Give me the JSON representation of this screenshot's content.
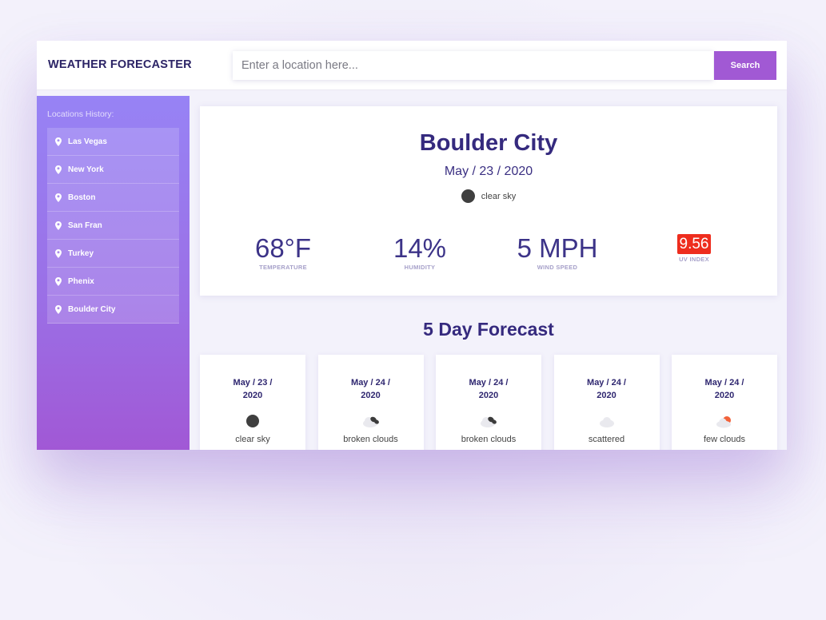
{
  "header": {
    "brand": "WEATHER FORECASTER",
    "search_placeholder": "Enter a location here...",
    "search_label": "Search"
  },
  "sidebar": {
    "title": "Locations History:",
    "items": [
      {
        "label": "Las Vegas",
        "icon": "map-pin-icon"
      },
      {
        "label": "New York",
        "icon": "map-pin-icon"
      },
      {
        "label": "Boston",
        "icon": "map-pin-icon"
      },
      {
        "label": "San Fran",
        "icon": "map-pin-icon"
      },
      {
        "label": "Turkey",
        "icon": "map-pin-icon"
      },
      {
        "label": "Phenix",
        "icon": "map-pin-icon"
      },
      {
        "label": "Boulder City",
        "icon": "map-pin-icon"
      }
    ]
  },
  "current": {
    "city": "Boulder City",
    "date": "May / 23 / 2020",
    "condition": "clear sky",
    "condition_icon": "clear-sky-icon",
    "temperature": "68°F",
    "temperature_label": "TEMPERATURE",
    "humidity": "14%",
    "humidity_label": "HUMIDITY",
    "wind": "5 MPH",
    "wind_label": "WIND SPEED",
    "uv": "9.56",
    "uv_label": "UV INDEX"
  },
  "forecast": {
    "title": "5 Day Forecast",
    "days": [
      {
        "date_line1": "May / 23 /",
        "date_line2": "2020",
        "desc": "clear sky",
        "icon": "clear-sky-icon"
      },
      {
        "date_line1": "May / 24 /",
        "date_line2": "2020",
        "desc": "broken clouds",
        "icon": "broken-clouds-icon"
      },
      {
        "date_line1": "May / 24 /",
        "date_line2": "2020",
        "desc": "broken clouds",
        "icon": "broken-clouds-icon"
      },
      {
        "date_line1": "May / 24 /",
        "date_line2": "2020",
        "desc": "scattered",
        "icon": "scattered-clouds-icon"
      },
      {
        "date_line1": "May / 24 /",
        "date_line2": "2020",
        "desc": "few clouds",
        "icon": "few-clouds-icon"
      }
    ]
  },
  "colors": {
    "brand_text": "#2c2466",
    "accent_button": "#a159d4",
    "sidebar_top": "#9783f5",
    "sidebar_bottom": "#a158d5",
    "heading": "#352a7e",
    "uv_badge": "#ee2d1e"
  }
}
